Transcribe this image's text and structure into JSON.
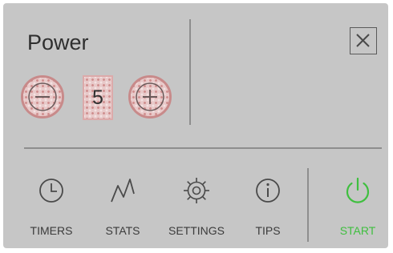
{
  "power": {
    "title": "Power",
    "value": "5"
  },
  "icons": {
    "close": "close-icon",
    "minus": "minus-icon",
    "plus": "plus-icon"
  },
  "nav": {
    "timers": {
      "label": "TIMERS",
      "icon": "clock-icon"
    },
    "stats": {
      "label": "STATS",
      "icon": "chart-line-icon"
    },
    "settings": {
      "label": "SETTINGS",
      "icon": "gear-icon"
    },
    "tips": {
      "label": "TIPS",
      "icon": "info-icon"
    },
    "start": {
      "label": "START",
      "icon": "power-icon"
    }
  },
  "colors": {
    "panel_bg": "#c6c6c6",
    "start_accent": "#3fbf3f",
    "stepper_highlight": "#d08f8f"
  }
}
